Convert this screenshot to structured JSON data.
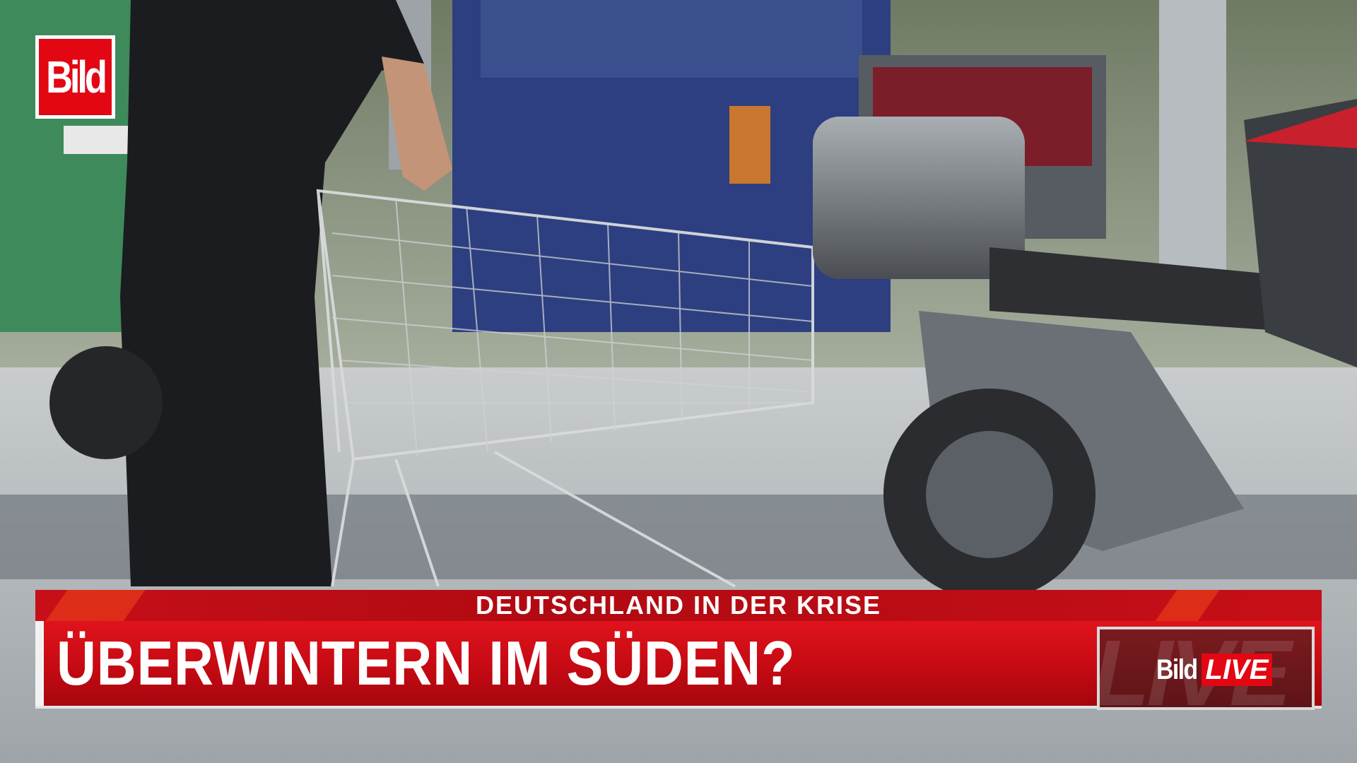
{
  "broadcast": {
    "logo_text": "Bild",
    "kicker": "DEUTSCHLAND IN DER KRISE",
    "headline": "ÜBERWINTERN IM SÜDEN?",
    "badge_brand": "Bild",
    "badge_live": "LIVE",
    "badge_ghost": "LIVE"
  },
  "colors": {
    "brand_red": "#e30613",
    "bar_red": "#c50a13",
    "badge_dark": "#6a171a"
  },
  "icons": [
    "bild-logo-icon",
    "bild-live-logo-icon"
  ]
}
